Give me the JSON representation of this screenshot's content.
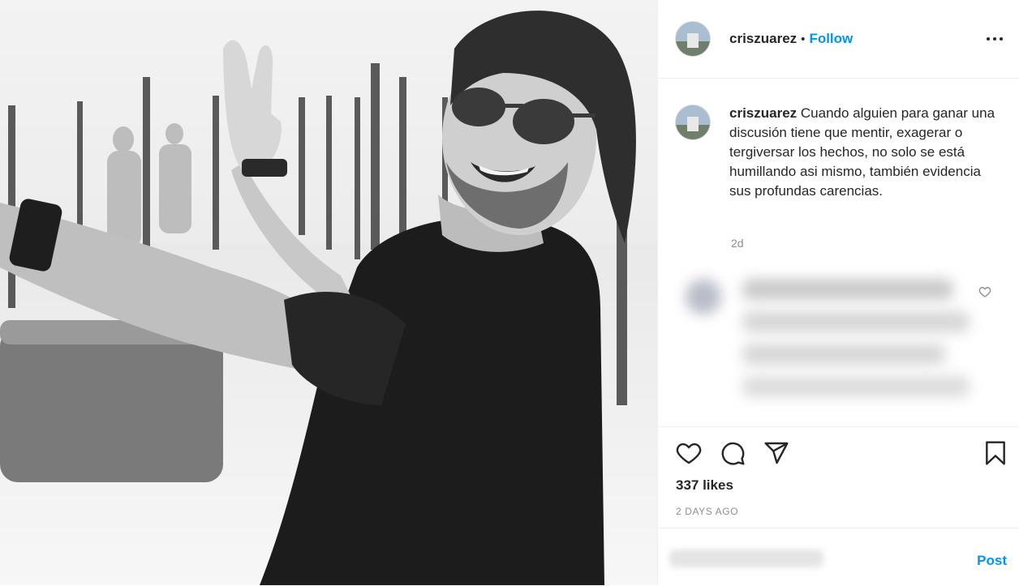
{
  "post": {
    "username": "criszuarez",
    "separator": "•",
    "follow_label": "Follow",
    "caption": "Cuando alguien para ganar una discusión tiene que mentir, exagerar o tergiversar los hechos, no solo se está humillando asi mismo, también evidencia sus profundas carencias.",
    "caption_age": "2d",
    "likes": "337 likes",
    "time_ago": "2 DAYS AGO",
    "post_label": "Post"
  },
  "icons": {
    "more": "more-options-icon",
    "like": "heart-icon",
    "comment": "comment-bubble-icon",
    "share": "paper-plane-icon",
    "save": "bookmark-icon"
  },
  "colors": {
    "accent": "#0095f6",
    "text": "#262626",
    "muted": "#8e8e8e",
    "border": "#efefef"
  }
}
